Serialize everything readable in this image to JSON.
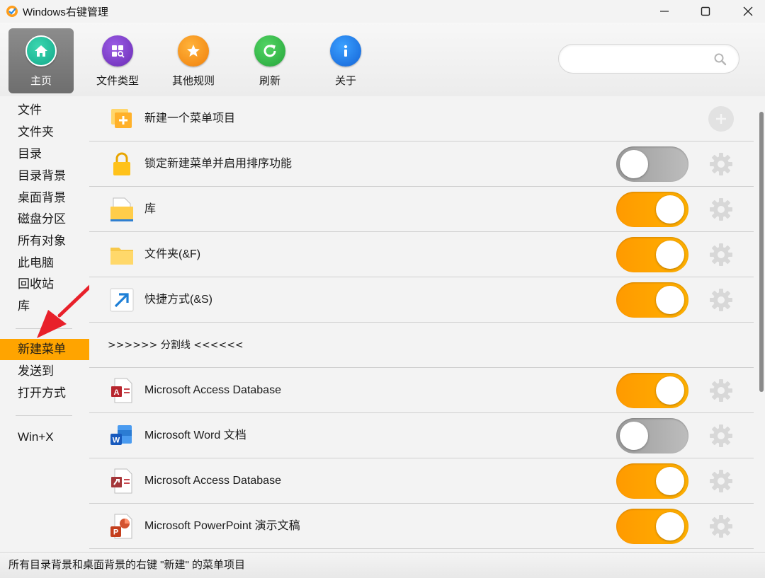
{
  "window": {
    "title": "Windows右键管理",
    "minimize_icon": "minimize-icon",
    "maximize_icon": "maximize-icon",
    "close_icon": "close-icon"
  },
  "toolbar": {
    "tools": [
      {
        "label": "主页",
        "icon": "home-icon",
        "active": true
      },
      {
        "label": "文件类型",
        "icon": "file-types-icon",
        "active": false
      },
      {
        "label": "其他规则",
        "icon": "star-icon",
        "active": false
      },
      {
        "label": "刷新",
        "icon": "refresh-icon",
        "active": false
      },
      {
        "label": "关于",
        "icon": "info-icon",
        "active": false
      }
    ],
    "search": {
      "value": "",
      "placeholder": "",
      "icon": "search-icon"
    }
  },
  "sidebar": {
    "items": [
      {
        "label": "文件"
      },
      {
        "label": "文件夹"
      },
      {
        "label": "目录"
      },
      {
        "label": "目录背景"
      },
      {
        "label": "桌面背景"
      },
      {
        "label": "磁盘分区"
      },
      {
        "label": "所有对象"
      },
      {
        "label": "此电脑"
      },
      {
        "label": "回收站"
      },
      {
        "label": "库"
      },
      {
        "label": "新建菜单",
        "selected": true
      },
      {
        "label": "发送到"
      },
      {
        "label": "打开方式"
      },
      {
        "label": "Win+X"
      }
    ]
  },
  "main": {
    "rows": [
      {
        "label": "新建一个菜单项目",
        "icon": "new-item-icon",
        "control": "add"
      },
      {
        "label": "锁定新建菜单并启用排序功能",
        "icon": "lock-icon",
        "toggle": false
      },
      {
        "label": "库",
        "icon": "library-icon",
        "toggle": true
      },
      {
        "label": "文件夹(&F)",
        "icon": "folder-icon",
        "toggle": true
      },
      {
        "label": "快捷方式(&S)",
        "icon": "shortcut-icon",
        "toggle": true
      },
      {
        "label": ">>>>>> 分割线 <<<<<<",
        "separator": true
      },
      {
        "label": "Microsoft Access Database",
        "icon": "access-icon",
        "toggle": true
      },
      {
        "label": "Microsoft Word 文档",
        "icon": "word-icon",
        "toggle": false
      },
      {
        "label": "Microsoft Access Database",
        "icon": "access-red-icon",
        "toggle": true
      },
      {
        "label": "Microsoft PowerPoint 演示文稿",
        "icon": "powerpoint-icon",
        "toggle": true
      }
    ]
  },
  "status": {
    "text": "所有目录背景和桌面背景的右键 \"新建\" 的菜单项目"
  },
  "colors": {
    "accent": "#ffa400",
    "toggle_on": "#ff9a00",
    "toggle_off": "#a8a8a8"
  }
}
